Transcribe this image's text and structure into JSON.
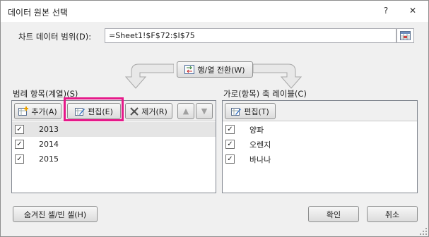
{
  "dialog": {
    "title": "데이터 원본 선택",
    "help_glyph": "?",
    "close_glyph": "✕"
  },
  "range": {
    "label": "차트 데이터 범위(D):",
    "value": "=Sheet1!$F$72:$I$75"
  },
  "switch_button": {
    "label": "행/열 전환(W)"
  },
  "legend": {
    "label": "범례 항목(계열)(S)",
    "add_label": "추가(A)",
    "edit_label": "편집(E)",
    "remove_label": "제거(R)",
    "up_glyph": "▲",
    "down_glyph": "▼",
    "items": [
      {
        "label": "2013",
        "checked": true
      },
      {
        "label": "2014",
        "checked": true
      },
      {
        "label": "2015",
        "checked": true
      }
    ]
  },
  "axis": {
    "label": "가로(항목) 축 레이블(C)",
    "edit_label": "편집(T)",
    "items": [
      {
        "label": "양파",
        "checked": true
      },
      {
        "label": "오렌지",
        "checked": true
      },
      {
        "label": "바나나",
        "checked": true
      }
    ]
  },
  "footer": {
    "hidden_cells_label": "숨겨진 셀/빈 셀(H)",
    "ok_label": "확인",
    "cancel_label": "취소"
  },
  "colors": {
    "highlight": "#e6198a"
  }
}
